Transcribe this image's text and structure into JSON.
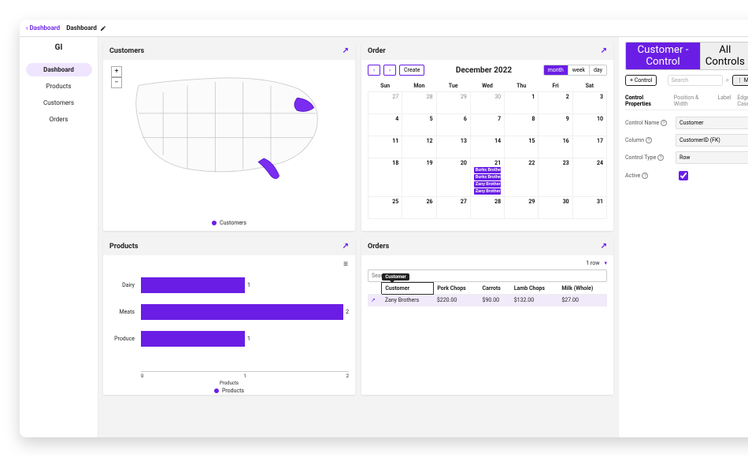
{
  "nav": {
    "back": "‹ Dashboard",
    "title": "Dashboard",
    "brand": "GI",
    "items": [
      {
        "label": "Dashboard",
        "active": true
      },
      {
        "label": "Products",
        "active": false
      },
      {
        "label": "Customers",
        "active": false
      },
      {
        "label": "Orders",
        "active": false
      }
    ]
  },
  "customers_panel": {
    "title": "Customers",
    "legend": "Customers",
    "zoom_in": "+",
    "zoom_out": "−"
  },
  "order_panel": {
    "title": "Order",
    "month_title": "December 2022",
    "create": "Create",
    "view": {
      "month": "month",
      "week": "week",
      "day": "day",
      "active": "month"
    },
    "days": [
      "Sun",
      "Mon",
      "Tue",
      "Wed",
      "Thu",
      "Fri",
      "Sat"
    ],
    "weeks": [
      [
        {
          "d": 27
        },
        {
          "d": 28
        },
        {
          "d": 29
        },
        {
          "d": 30
        },
        {
          "d": 1,
          "in": true
        },
        {
          "d": 2,
          "in": true
        },
        {
          "d": 3,
          "in": true
        }
      ],
      [
        {
          "d": 4,
          "in": true
        },
        {
          "d": 5,
          "in": true
        },
        {
          "d": 6,
          "in": true
        },
        {
          "d": 7,
          "in": true
        },
        {
          "d": 8,
          "in": true
        },
        {
          "d": 9,
          "in": true
        },
        {
          "d": 10,
          "in": true
        }
      ],
      [
        {
          "d": 11,
          "in": true
        },
        {
          "d": 12,
          "in": true
        },
        {
          "d": 13,
          "in": true
        },
        {
          "d": 14,
          "in": true
        },
        {
          "d": 15,
          "in": true
        },
        {
          "d": 16,
          "in": true
        },
        {
          "d": 17,
          "in": true
        }
      ],
      [
        {
          "d": 18,
          "in": true
        },
        {
          "d": 19,
          "in": true
        },
        {
          "d": 20,
          "in": true
        },
        {
          "d": 21,
          "in": true,
          "events": [
            "Burks Brothers",
            "Burks Brothers",
            "Zany Brothers",
            "Zany Brothers"
          ]
        },
        {
          "d": 22,
          "in": true
        },
        {
          "d": 23,
          "in": true
        },
        {
          "d": 24,
          "in": true
        }
      ],
      [
        {
          "d": 25,
          "in": true
        },
        {
          "d": 26,
          "in": true
        },
        {
          "d": 27,
          "in": true
        },
        {
          "d": 28,
          "in": true
        },
        {
          "d": 29,
          "in": true
        },
        {
          "d": 30,
          "in": true
        },
        {
          "d": 31,
          "in": true
        }
      ]
    ]
  },
  "products_panel": {
    "title": "Products"
  },
  "chart_data": {
    "type": "bar",
    "orientation": "horizontal",
    "categories": [
      "Dairy",
      "Meats",
      "Produce"
    ],
    "values": [
      1,
      2,
      1
    ],
    "xlabel": "Products",
    "xlim": [
      0,
      2
    ],
    "legend": "Products"
  },
  "orders_panel": {
    "title": "Orders",
    "row_count": "1 row",
    "search_placeholder": "Search",
    "tooltip": "Customer",
    "columns": [
      "",
      "Customer",
      "Pork Chops",
      "Carrots",
      "Lamb Chops",
      "Milk (Whole)"
    ],
    "rows": [
      {
        "open": "↗",
        "Customer": "Zany Brothers",
        "Pork Chops": "$220.00",
        "Carrots": "$90.00",
        "Lamb Chops": "$132.00",
        "Milk (Whole)": "$27.00"
      }
    ]
  },
  "props": {
    "scope_tabs": {
      "this": "Customer - Control",
      "all": "All Controls"
    },
    "add": "+ Control",
    "search_placeholder": "Search",
    "more": "⋮ More",
    "tabs": [
      "Control Properties",
      "Position & Width",
      "Label",
      "Edge Case"
    ],
    "active_tab": 0,
    "fields": {
      "control_name": {
        "label": "Control Name",
        "value": "Customer"
      },
      "column": {
        "label": "Column",
        "value": "CustomerID (FK)"
      },
      "control_type": {
        "label": "Control Type",
        "value": "Row"
      },
      "active": {
        "label": "Active",
        "value": true
      }
    }
  }
}
